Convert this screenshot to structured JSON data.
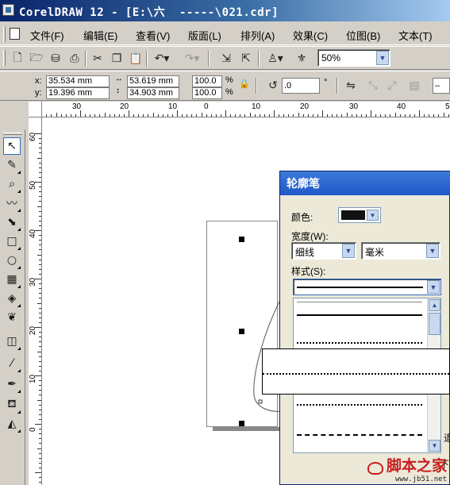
{
  "window": {
    "title": "CorelDRAW 12 - [E:\\六  -----\\021.cdr]"
  },
  "menu": [
    "文件(F)",
    "编辑(E)",
    "查看(V)",
    "版面(L)",
    "排列(A)",
    "效果(C)",
    "位图(B)",
    "文本(T)"
  ],
  "toolbar": {
    "icons": [
      "new-icon",
      "open-icon",
      "save-icon",
      "print-icon",
      "cut-icon",
      "copy-icon",
      "paste-icon",
      "undo-icon",
      "redo-icon",
      "import-icon",
      "export-icon",
      "application-launcher-icon",
      "corel-online-icon"
    ],
    "zoom": "50%"
  },
  "property_bar": {
    "x_label": "x:",
    "y_label": "y:",
    "x": "35.534 mm",
    "y": "19.396 mm",
    "width": "53.619 mm",
    "height": "34.903 mm",
    "scale_x": "100.0",
    "scale_y": "100.0",
    "percent": "%",
    "rotation": ".0",
    "degree": "°"
  },
  "ruler": {
    "unit_h": "毫米",
    "h_labels": [
      "30",
      "20",
      "10",
      "0",
      "10",
      "20",
      "30",
      "40",
      "50"
    ],
    "v_labels": [
      "60",
      "50",
      "40",
      "30",
      "20",
      "10",
      "0"
    ]
  },
  "toolbox": [
    "pick-tool-icon",
    "shape-tool-icon",
    "zoom-tool-icon",
    "freehand-tool-icon",
    "smart-fill-tool-icon",
    "rectangle-tool-icon",
    "ellipse-tool-icon",
    "graph-paper-tool-icon",
    "basic-shapes-tool-icon",
    "text-tool-icon",
    "interactive-blend-tool-icon",
    "eyedropper-tool-icon",
    "outline-tool-icon",
    "fill-tool-icon",
    "interactive-fill-tool-icon"
  ],
  "dialog": {
    "title": "轮廓笔",
    "color_label": "颜色:",
    "width_label": "宽度(W):",
    "width_value": "细线",
    "unit_value": "毫米",
    "style_label": "样式(S):",
    "bottom_left_fragment": "",
    "bottom_right_fragment": "下",
    "right_edge_fragment": "退"
  },
  "watermark": {
    "main": "脚本之家",
    "sub": "www.jb51.net"
  }
}
